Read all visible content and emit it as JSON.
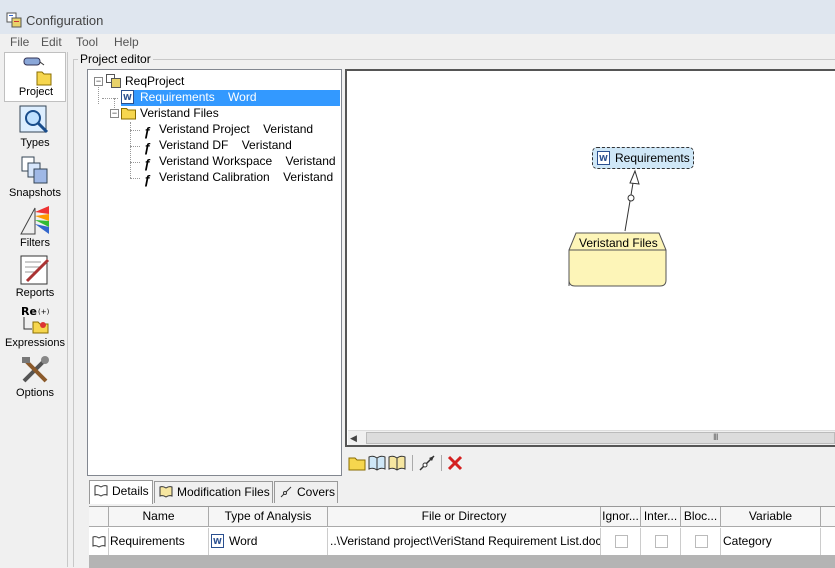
{
  "window": {
    "title": "Configuration"
  },
  "menu": [
    "File",
    "Edit",
    "Tool",
    "Help"
  ],
  "sidebar": {
    "items": [
      {
        "label": "Project",
        "icon": "project-icon",
        "selected": true
      },
      {
        "label": "Types",
        "icon": "types-icon"
      },
      {
        "label": "Snapshots",
        "icon": "snapshots-icon"
      },
      {
        "label": "Filters",
        "icon": "filters-icon"
      },
      {
        "label": "Reports",
        "icon": "reports-icon"
      },
      {
        "label": "Expressions",
        "icon": "expressions-icon"
      },
      {
        "label": "Options",
        "icon": "options-icon"
      }
    ]
  },
  "editor": {
    "group_title": "Project editor"
  },
  "tree": {
    "root": "ReqProject",
    "nodes": [
      {
        "name": "Requirements",
        "type": "Word",
        "selected": true
      },
      {
        "name": "Veristand Files",
        "type": ""
      },
      {
        "name": "Veristand Project",
        "type": "Veristand"
      },
      {
        "name": "Veristand DF",
        "type": "Veristand"
      },
      {
        "name": "Veristand Workspace",
        "type": "Veristand"
      },
      {
        "name": "Veristand Calibration",
        "type": "Veristand"
      }
    ]
  },
  "diagram": {
    "requirements_node": "Requirements",
    "folder_node": "Veristand Files",
    "scroll_grip": "III"
  },
  "toolbar": {
    "buttons": [
      "add-folder-icon",
      "add-document-icon",
      "add-documents-icon",
      "link-icon",
      "delete-icon"
    ]
  },
  "tabs": [
    {
      "label": "Details",
      "active": true
    },
    {
      "label": "Modification Files"
    },
    {
      "label": "Covers"
    }
  ],
  "table": {
    "columns": [
      "Name",
      "Type of Analysis",
      "File or Directory",
      "Ignor...",
      "Inter...",
      "Bloc...",
      "Variable"
    ],
    "rows": [
      {
        "name": "Requirements",
        "type": "Word",
        "file": "..\\Veristand project\\VeriStand Requirement List.docx",
        "variable": "Category"
      }
    ]
  },
  "colors": {
    "selection": "#3399ff",
    "req_node_fill": "#cfe7f7",
    "folder_fill": "#fdf5b8",
    "delete": "#d42020"
  }
}
